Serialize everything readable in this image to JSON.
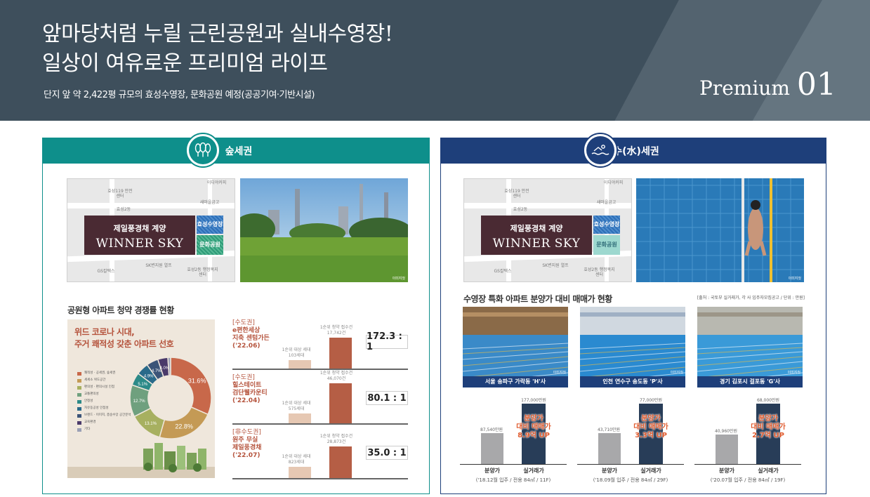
{
  "header": {
    "title_line1": "앞마당처럼 누릴 근린공원과 실내수영장!",
    "title_line2": "일상이 여유로운 프리미엄 라이프",
    "subtitle": "단지 앞 약 2,422평 규모의 효성수영장, 문화공원 예정(공공기여·기반시설)",
    "premium_word": "Premium",
    "premium_num": "01"
  },
  "left": {
    "title": "숲세권",
    "map": {
      "brand_top": "제일풍경채 계양",
      "brand_bottom": "WINNER SKY",
      "tag_pool": "효성수영장",
      "tag_park": "문화공원",
      "labels": [
        "효성119 안전센터",
        "효성2동",
        "SK변지원 열프",
        "효성2동 행정복지센터",
        "GS칼텍스",
        "이디야커피",
        "새마을금고"
      ]
    },
    "photo_caption": "이미지컷",
    "section_title": "공원형 아파트 청약 경쟁률 현황",
    "donut_title1": "위드 코로나 시대,",
    "donut_title2": "주거 쾌적성 갖춘 아파트 선호",
    "legend": [
      "쾌적성 · 공세권, 숲세권",
      "세세소 위도공간",
      "편의성 · 편의시설 인접",
      "교통편의성",
      "안정성",
      "자유동공성 인접성",
      "브랜드 · 이미지, 층숭수망 공간분석",
      "교육환경",
      "기타"
    ],
    "items": [
      {
        "region": "[수도권]",
        "name1": "e편한세상",
        "name2": "지축 센텀가든",
        "date": "('22.06)",
        "small_top": "1순위 대상 세대",
        "small_val": "103세대",
        "big_top": "1순위 청약 접수건",
        "big_val": "17,742건",
        "ratio": "172.3 : 1"
      },
      {
        "region": "[수도권]",
        "name1": "힐스테이트",
        "name2": "검단웰카운티",
        "date": "('22.04)",
        "small_top": "1순위 대상 세대",
        "small_val": "575세대",
        "big_top": "1순위 청약 접수건",
        "big_val": "46,070건",
        "ratio": "80.1 : 1"
      },
      {
        "region": "[非수도권]",
        "name1": "원주 무실",
        "name2": "제일풍경채",
        "date": "('22.07)",
        "small_top": "1순위 대상 세대",
        "small_val": "823세대",
        "big_top": "1순위 청약 접수건",
        "big_val": "28,873건",
        "ratio": "35.0 : 1"
      }
    ]
  },
  "right": {
    "title": "수(水)세권",
    "map": {
      "brand_top": "제일풍경채 계양",
      "brand_bottom": "WINNER SKY",
      "tag_pool": "효성수영장",
      "tag_park": "문화공원"
    },
    "photo_caption": "이미지컷",
    "section_title": "수영장 특화 아파트 분양가 대비 매매가 현황",
    "source": "[출처 : 국토부 실거래가, 각 사 입주자모집공고 / 단위 : 만원]",
    "pools": [
      {
        "caption": "서울 송파구 가락동 'H'사",
        "sale": "87,540만원",
        "market": "177,000만원",
        "up1": "분양가",
        "up2": "대비 매매가",
        "up3": "8.9억 UP",
        "x1": "분양가",
        "x2": "실거래가",
        "foot": "('18.12월 입주 / 전용 84㎡ / 11F)",
        "sale_v": 87540,
        "market_v": 177000
      },
      {
        "caption": "인천 연수구 송도동 'P'사",
        "sale": "43,710만원",
        "market": "77,000만원",
        "up1": "분양가",
        "up2": "대비 매매가",
        "up3": "3.3억 UP",
        "x1": "분양가",
        "x2": "실거래가",
        "foot": "('18.09월 입주 / 전용 84㎡ / 29F)",
        "sale_v": 43710,
        "market_v": 77000
      },
      {
        "caption": "경기 김포시 걸포동 'G'사",
        "sale": "40,960만원",
        "market": "68,000만원",
        "up1": "분양가",
        "up2": "대비 매매가",
        "up3": "2.7억 UP",
        "x1": "분양가",
        "x2": "실거래가",
        "foot": "('20.07월 입주 / 전용 84㎡ / 19F)",
        "sale_v": 40960,
        "market_v": 68000
      }
    ]
  },
  "chart_data": [
    {
      "type": "pie",
      "title": "위드 코로나 시대, 주거 쾌적성 갖춘 아파트 선호",
      "categories": [
        "쾌적성 · 공세권, 숲세권",
        "세세소 위도공간",
        "편의성 · 편의시설 인접",
        "교통편의성",
        "안정성",
        "자유동공성 인접성",
        "브랜드 · 이미지, 층숭수망 공간분석",
        "교육환경",
        "기타"
      ],
      "values": [
        31.6,
        22.8,
        13.1,
        12.7,
        5.1,
        4.9,
        4.7,
        4.0,
        1.1
      ],
      "colors": [
        "#c8684a",
        "#c49a55",
        "#a7b060",
        "#6fa07e",
        "#2c8a88",
        "#2a6a8a",
        "#3b5478",
        "#4a3a6a",
        "#9aa0b5"
      ]
    },
    {
      "type": "bar",
      "title": "공원형 아파트 청약 경쟁률 현황",
      "categories": [
        "e편한세상 지축 센텀가든",
        "힐스테이트 검단웰카운티",
        "원주 무실 제일풍경채"
      ],
      "series": [
        {
          "name": "1순위 대상 세대",
          "values": [
            103,
            575,
            823
          ]
        },
        {
          "name": "1순위 청약 접수건",
          "values": [
            17742,
            46070,
            28873
          ]
        }
      ]
    },
    {
      "type": "bar",
      "title": "수영장 특화 아파트 분양가 대비 매매가 현황",
      "categories": [
        "서울 송파구 가락동 'H'사",
        "인천 연수구 송도동 'P'사",
        "경기 김포시 걸포동 'G'사"
      ],
      "series": [
        {
          "name": "분양가",
          "values": [
            87540,
            43710,
            40960
          ]
        },
        {
          "name": "실거래가",
          "values": [
            177000,
            77000,
            68000
          ]
        }
      ]
    }
  ]
}
